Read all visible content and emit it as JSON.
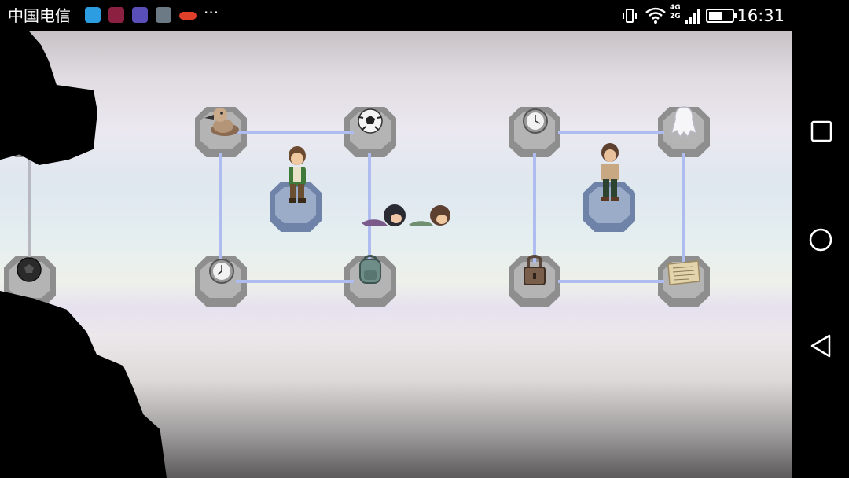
{
  "status_bar": {
    "carrier": "中国电信",
    "time": "16:31",
    "network_badge": "4G 2G",
    "icons": [
      "message-icon",
      "game-app-icon",
      "browser-icon",
      "gallery-icon",
      "notification-badge-icon",
      "more-dots-icon",
      "vibrate-icon",
      "wifi-icon",
      "signal-icon",
      "battery-icon"
    ]
  },
  "nav_bar": {
    "icons": [
      "recent-apps-icon",
      "home-icon",
      "back-icon"
    ]
  },
  "scene": {
    "pedestal_items": [
      "duck-toy",
      "soccer-ball",
      "clock",
      "ghost-doll",
      "soccer-ball",
      "clock",
      "backpack",
      "padlock",
      "paper-note"
    ],
    "characters": [
      "boy-green-shirt",
      "boy-dark-pants",
      "fallen-girl-dark-hair",
      "fallen-boy-brown-hair"
    ]
  },
  "colors": {
    "connector": "#aebcf0",
    "pedestal": "#8e8e8e",
    "pedestal_blue": "#6f83a8",
    "silhouette": "#000000"
  }
}
